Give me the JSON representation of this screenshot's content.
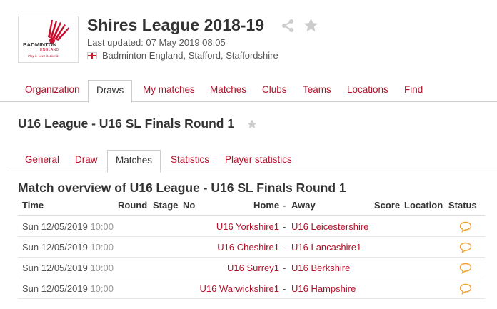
{
  "header": {
    "logo_line1": "BADMINTON",
    "logo_line2": "ENGLAND",
    "logo_tagline": "Play it. Love it. Live it.",
    "title": "Shires League 2018-19",
    "updated": "Last updated: 07 May 2019 08:05",
    "location": "Badminton England, Stafford, Staffordshire"
  },
  "main_tabs": [
    "Organization",
    "Draws",
    "My matches",
    "Matches",
    "Clubs",
    "Teams",
    "Locations",
    "Find"
  ],
  "active_main_tab": "Draws",
  "draw_title": "U16 League - U16 SL Finals Round 1",
  "sub_tabs": [
    "General",
    "Draw",
    "Matches",
    "Statistics",
    "Player statistics"
  ],
  "active_sub_tab": "Matches",
  "overview_title": "Match overview of U16 League - U16 SL Finals Round 1",
  "columns": {
    "time": "Time",
    "round": "Round",
    "stage": "Stage",
    "no": "No",
    "home": "Home",
    "dash": "-",
    "away": "Away",
    "score": "Score",
    "location": "Location",
    "status": "Status"
  },
  "matches": [
    {
      "date": "Sun 12/05/2019",
      "time": "10:00",
      "home": "U16 Yorkshire1",
      "away": "U16 Leicestershire"
    },
    {
      "date": "Sun 12/05/2019",
      "time": "10:00",
      "home": "U16 Cheshire1",
      "away": "U16 Lancashire1"
    },
    {
      "date": "Sun 12/05/2019",
      "time": "10:00",
      "home": "U16 Surrey1",
      "away": "U16 Berkshire"
    },
    {
      "date": "Sun 12/05/2019",
      "time": "10:00",
      "home": "U16 Warwickshire1",
      "away": "U16 Hampshire"
    }
  ],
  "colors": {
    "link": "#b3122b",
    "status_icon": "#f0a030",
    "star": "#cccccc"
  }
}
